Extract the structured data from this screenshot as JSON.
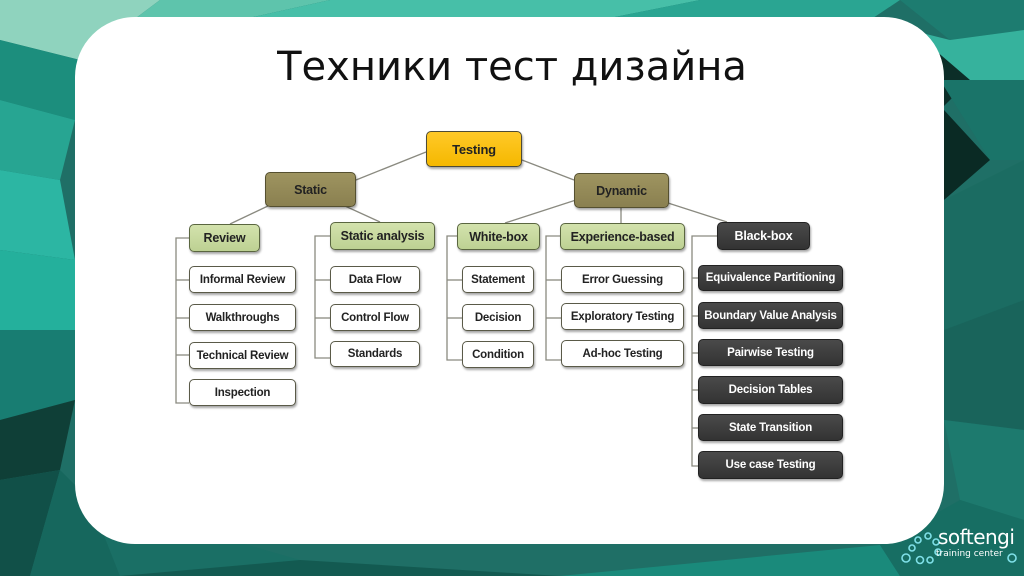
{
  "slide": {
    "title": "Техники тест дизайна"
  },
  "colors": {
    "root": "#FFC000",
    "category": "#948A54",
    "subcategory": "#C3D69B",
    "leaf": "#FFFFFF",
    "dark": "#3A3A3A",
    "background": "#1E6F67"
  },
  "tree": {
    "root": "Testing",
    "static": {
      "label": "Static",
      "review": {
        "label": "Review",
        "items": [
          "Informal Review",
          "Walkthroughs",
          "Technical Review",
          "Inspection"
        ]
      },
      "analysis": {
        "label": "Static analysis",
        "items": [
          "Data Flow",
          "Control Flow",
          "Standards"
        ]
      }
    },
    "dynamic": {
      "label": "Dynamic",
      "whitebox": {
        "label": "White-box",
        "items": [
          "Statement",
          "Decision",
          "Condition"
        ]
      },
      "experience": {
        "label": "Experience-based",
        "items": [
          "Error Guessing",
          "Exploratory Testing",
          "Ad-hoc Testing"
        ]
      },
      "blackbox": {
        "label": "Black-box",
        "items": [
          "Equivalence Partitioning",
          "Boundary Value Analysis",
          "Pairwise Testing",
          "Decision Tables",
          "State Transition",
          "Use case Testing"
        ]
      }
    }
  },
  "logo": {
    "name": "softengi",
    "tagline": "training center"
  }
}
